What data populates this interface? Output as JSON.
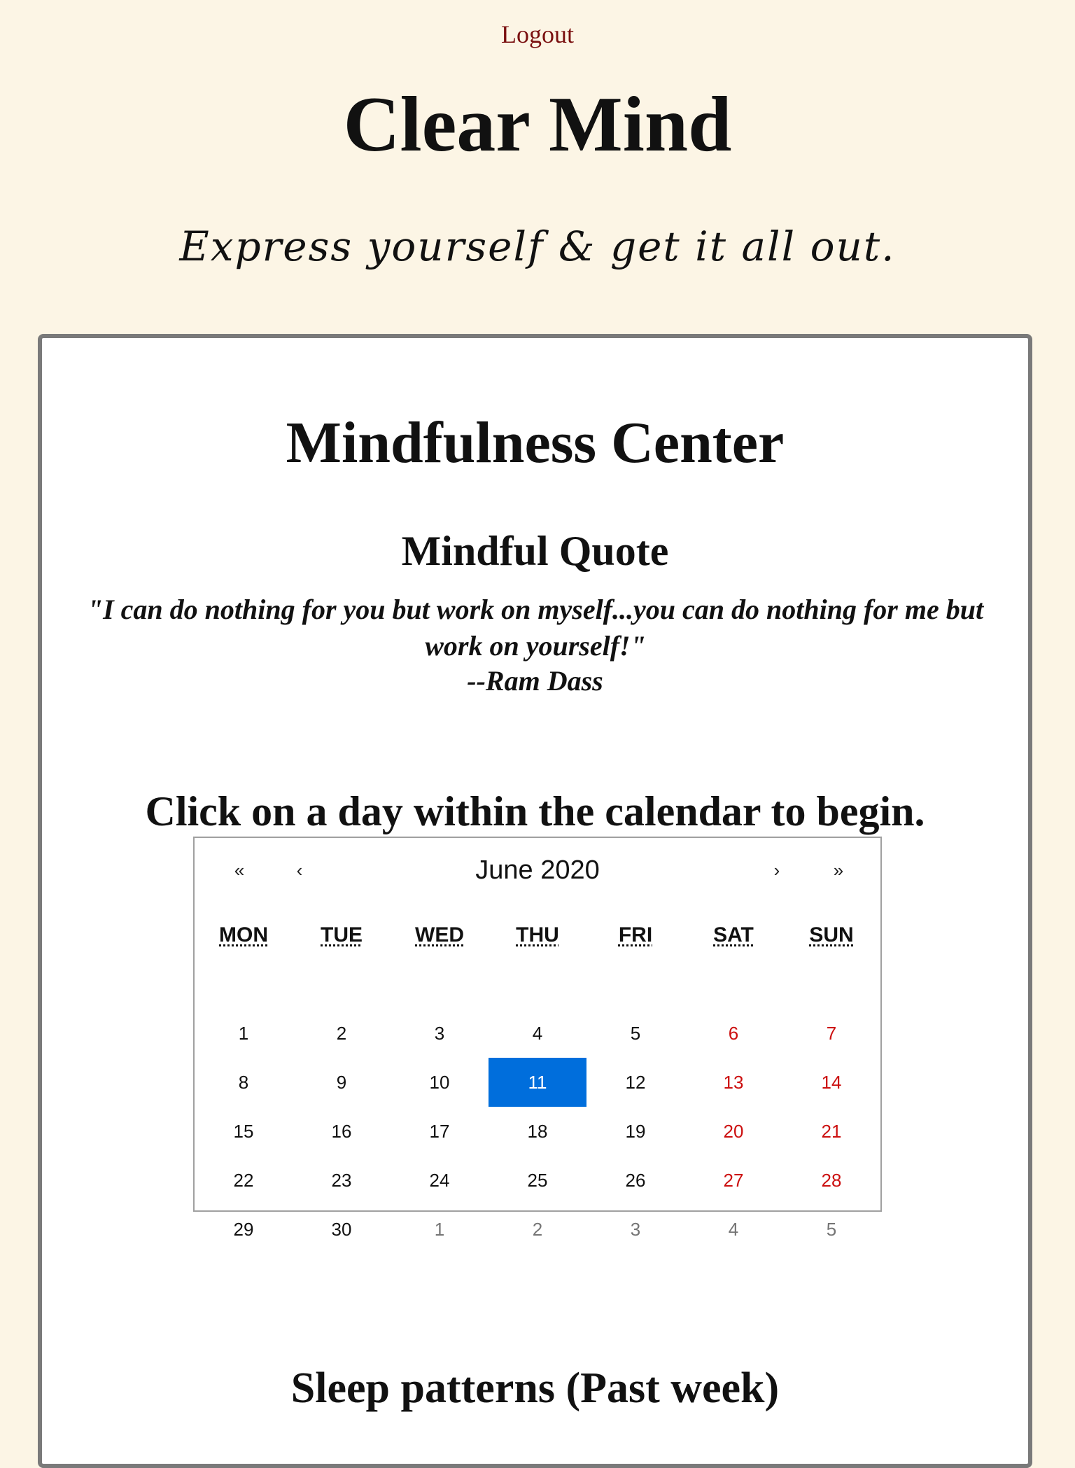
{
  "header": {
    "logout_label": "Logout",
    "site_title": "Clear Mind",
    "tagline": "Express yourself & get it all out."
  },
  "main": {
    "title": "Mindfulness Center",
    "quote": {
      "heading": "Mindful Quote",
      "text": "\"I can do nothing for you but work on myself...you can do nothing for me but work on yourself!\"",
      "author": "--Ram Dass"
    },
    "instructions": "Click on a day within the calendar to begin.",
    "sleep_heading": "Sleep patterns (Past week)"
  },
  "calendar": {
    "prev_year_label": "«",
    "prev_month_label": "‹",
    "month_label": "June 2020",
    "next_month_label": "›",
    "next_year_label": "»",
    "weekdays": [
      "MON",
      "TUE",
      "WED",
      "THU",
      "FRI",
      "SAT",
      "SUN"
    ],
    "days": [
      {
        "label": "1",
        "weekend": false,
        "neighbor": false,
        "active": false
      },
      {
        "label": "2",
        "weekend": false,
        "neighbor": false,
        "active": false
      },
      {
        "label": "3",
        "weekend": false,
        "neighbor": false,
        "active": false
      },
      {
        "label": "4",
        "weekend": false,
        "neighbor": false,
        "active": false
      },
      {
        "label": "5",
        "weekend": false,
        "neighbor": false,
        "active": false
      },
      {
        "label": "6",
        "weekend": true,
        "neighbor": false,
        "active": false
      },
      {
        "label": "7",
        "weekend": true,
        "neighbor": false,
        "active": false
      },
      {
        "label": "8",
        "weekend": false,
        "neighbor": false,
        "active": false
      },
      {
        "label": "9",
        "weekend": false,
        "neighbor": false,
        "active": false
      },
      {
        "label": "10",
        "weekend": false,
        "neighbor": false,
        "active": false
      },
      {
        "label": "11",
        "weekend": false,
        "neighbor": false,
        "active": true
      },
      {
        "label": "12",
        "weekend": false,
        "neighbor": false,
        "active": false
      },
      {
        "label": "13",
        "weekend": true,
        "neighbor": false,
        "active": false
      },
      {
        "label": "14",
        "weekend": true,
        "neighbor": false,
        "active": false
      },
      {
        "label": "15",
        "weekend": false,
        "neighbor": false,
        "active": false
      },
      {
        "label": "16",
        "weekend": false,
        "neighbor": false,
        "active": false
      },
      {
        "label": "17",
        "weekend": false,
        "neighbor": false,
        "active": false
      },
      {
        "label": "18",
        "weekend": false,
        "neighbor": false,
        "active": false
      },
      {
        "label": "19",
        "weekend": false,
        "neighbor": false,
        "active": false
      },
      {
        "label": "20",
        "weekend": true,
        "neighbor": false,
        "active": false
      },
      {
        "label": "21",
        "weekend": true,
        "neighbor": false,
        "active": false
      },
      {
        "label": "22",
        "weekend": false,
        "neighbor": false,
        "active": false
      },
      {
        "label": "23",
        "weekend": false,
        "neighbor": false,
        "active": false
      },
      {
        "label": "24",
        "weekend": false,
        "neighbor": false,
        "active": false
      },
      {
        "label": "25",
        "weekend": false,
        "neighbor": false,
        "active": false
      },
      {
        "label": "26",
        "weekend": false,
        "neighbor": false,
        "active": false
      },
      {
        "label": "27",
        "weekend": true,
        "neighbor": false,
        "active": false
      },
      {
        "label": "28",
        "weekend": true,
        "neighbor": false,
        "active": false
      },
      {
        "label": "29",
        "weekend": false,
        "neighbor": false,
        "active": false
      },
      {
        "label": "30",
        "weekend": false,
        "neighbor": false,
        "active": false
      },
      {
        "label": "1",
        "weekend": false,
        "neighbor": true,
        "active": false
      },
      {
        "label": "2",
        "weekend": false,
        "neighbor": true,
        "active": false
      },
      {
        "label": "3",
        "weekend": false,
        "neighbor": true,
        "active": false
      },
      {
        "label": "4",
        "weekend": false,
        "neighbor": true,
        "active": false
      },
      {
        "label": "5",
        "weekend": false,
        "neighbor": true,
        "active": false
      }
    ]
  },
  "colors": {
    "page_background": "#fcf5e5",
    "logout_link": "#7a1010",
    "weekend": "#cc1010",
    "neighbor_month": "#757575",
    "selected_day": "#006edc"
  }
}
